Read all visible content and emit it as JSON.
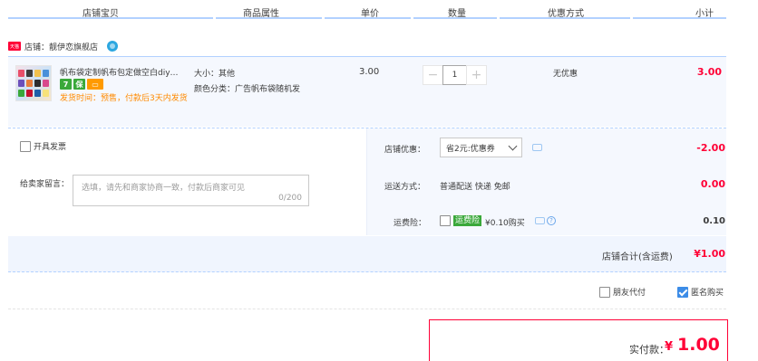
{
  "table_header": {
    "columns": [
      "店铺宝贝",
      "商品属性",
      "单价",
      "数量",
      "优惠方式",
      "小计"
    ]
  },
  "shop": {
    "badge": "天猫",
    "name": "店铺：靓伊恋旗舰店"
  },
  "item": {
    "title": "帆布袋定制帆布包定做空白diy…",
    "service_icons": [
      {
        "name": "seven-day-return-icon",
        "glyph": "7",
        "color": "#3aa83a"
      },
      {
        "name": "guarantee-icon",
        "glyph": "保",
        "color": "#3aa83a"
      },
      {
        "name": "card-payment-icon",
        "glyph": "▭",
        "color": "#ff9a00"
      }
    ],
    "ship_note": "发货时间：预售，付款后3天内发货",
    "sku_size": "大小：其他",
    "sku_color": "颜色分类：广告帆布袋随机发",
    "unit_price": "3.00",
    "quantity": "1",
    "qty_minus": "−",
    "qty_plus": "+",
    "promotion": "无优惠",
    "subtotal": "3.00"
  },
  "order": {
    "invoice_label": "开具发票",
    "memo_label": "给卖家留言：",
    "memo_placeholder": "选填，请先和商家协商一致，付款后商家可见",
    "memo_count": "0/200",
    "shop_coupon_label": "店铺优惠：",
    "shop_coupon_value": "省2元:优惠券",
    "shop_coupon_amount": "-2.00",
    "shipping_label": "运送方式：",
    "shipping_value": "普通配送 快递 免邮",
    "shipping_amount": "0.00",
    "insurance_label": "运费险：",
    "insurance_tag": "运费险",
    "insurance_price": "¥0.10购买",
    "insurance_amount": "0.10",
    "shop_total_label": "店铺合计(含运费)",
    "shop_total_value": "¥1.00"
  },
  "footer": {
    "pay_for_friend": "朋友代付",
    "anonymous_buy": "匿名购买",
    "anonymous_checked": true,
    "pay_label": "实付款：",
    "pay_currency": "¥",
    "pay_amount": "1.00"
  },
  "colors": {
    "accent_red": "#ff0036",
    "accent_blue": "#3c8ce7",
    "light_bg": "#f5f8fe",
    "header_line": "#b2d1ff"
  }
}
